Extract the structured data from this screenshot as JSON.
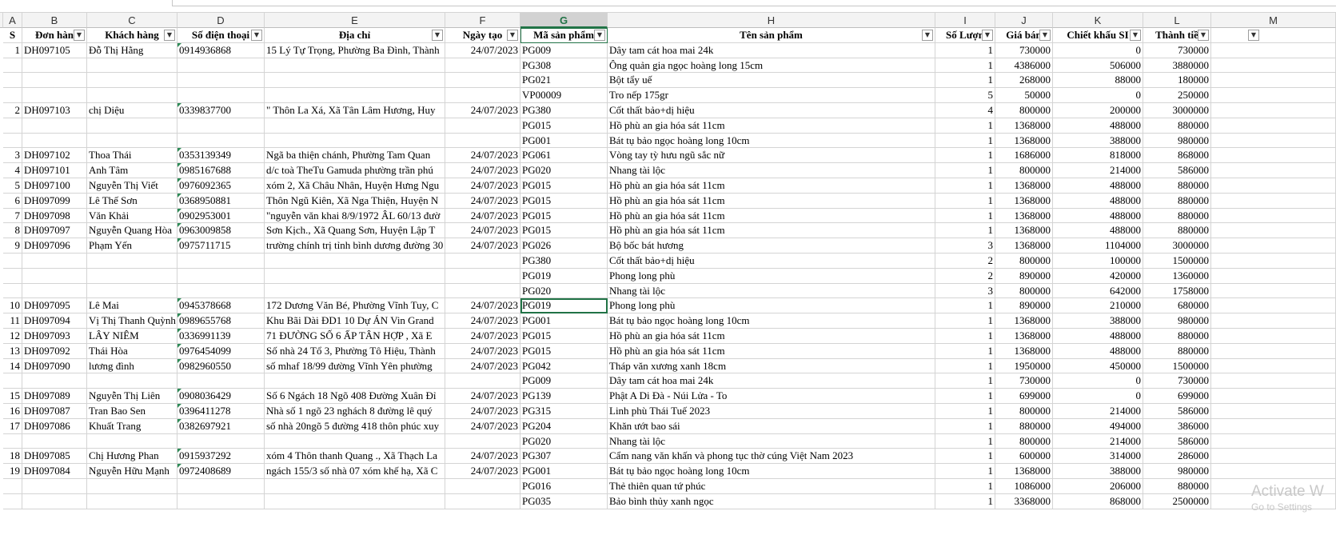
{
  "column_letters": [
    "A",
    "B",
    "C",
    "D",
    "E",
    "F",
    "G",
    "H",
    "I",
    "J",
    "K",
    "L",
    "M"
  ],
  "selected_column": "G",
  "headers": [
    "S",
    "Đơn hàn",
    "Khách hàng",
    "Số điện thoại",
    "Địa chỉ",
    "Ngày tạo",
    "Mã sản phẩm",
    "Tên sản phẩm",
    "Số Lượn",
    "Giá bán",
    "Chiết khấu SI",
    "Thành tiề"
  ],
  "rows": [
    {
      "stt": "1",
      "don": "DH097105",
      "kh": "Đỗ Thị Hằng",
      "sdt": "0914936868",
      "dc": "15 Lý Tự Trọng, Phường Ba Đình, Thành",
      "ngay": "24/07/2023",
      "ma": "PG009",
      "ten": "Dây tam cát hoa mai 24k",
      "sl": "1",
      "gia": "730000",
      "ck": "0",
      "tt": "730000"
    },
    {
      "stt": "",
      "don": "",
      "kh": "",
      "sdt": "",
      "dc": "",
      "ngay": "",
      "ma": "PG308",
      "ten": "Ông quản gia ngọc hoàng long 15cm",
      "sl": "1",
      "gia": "4386000",
      "ck": "506000",
      "tt": "3880000"
    },
    {
      "stt": "",
      "don": "",
      "kh": "",
      "sdt": "",
      "dc": "",
      "ngay": "",
      "ma": "PG021",
      "ten": "Bột tẩy uế",
      "sl": "1",
      "gia": "268000",
      "ck": "88000",
      "tt": "180000"
    },
    {
      "stt": "",
      "don": "",
      "kh": "",
      "sdt": "",
      "dc": "",
      "ngay": "",
      "ma": "VP00009",
      "ten": "Tro nếp 175gr",
      "sl": "5",
      "gia": "50000",
      "ck": "0",
      "tt": "250000"
    },
    {
      "stt": "2",
      "don": "DH097103",
      "kh": "chị  Diệu",
      "sdt": "0339837700",
      "dc": "\" Thôn La Xá, Xã Tân Lâm Hương, Huy",
      "ngay": "24/07/2023",
      "ma": "PG380",
      "ten": "Cốt thất bảo+dị hiệu",
      "sl": "4",
      "gia": "800000",
      "ck": "200000",
      "tt": "3000000"
    },
    {
      "stt": "",
      "don": "",
      "kh": "",
      "sdt": "",
      "dc": "",
      "ngay": "",
      "ma": "PG015",
      "ten": "Hồ phù an gia hóa sát 11cm",
      "sl": "1",
      "gia": "1368000",
      "ck": "488000",
      "tt": "880000"
    },
    {
      "stt": "",
      "don": "",
      "kh": "",
      "sdt": "",
      "dc": "",
      "ngay": "",
      "ma": "PG001",
      "ten": "Bát tụ bảo ngọc hoàng long 10cm",
      "sl": "1",
      "gia": "1368000",
      "ck": "388000",
      "tt": "980000"
    },
    {
      "stt": "3",
      "don": "DH097102",
      "kh": "Thoa  Thái",
      "sdt": "0353139349",
      "dc": "Ngã ba thiện chánh, Phường Tam Quan",
      "ngay": "24/07/2023",
      "ma": "PG061",
      "ten": "Vòng tay tỳ hưu ngũ sắc nữ",
      "sl": "1",
      "gia": "1686000",
      "ck": "818000",
      "tt": "868000"
    },
    {
      "stt": "4",
      "don": "DH097101",
      "kh": "Anh Tâm",
      "sdt": "0985167688",
      "dc": " d/c toà TheTu Gamuda phường trần phú",
      "ngay": "24/07/2023",
      "ma": "PG020",
      "ten": "Nhang tài lộc",
      "sl": "1",
      "gia": "800000",
      "ck": "214000",
      "tt": "586000"
    },
    {
      "stt": "5",
      "don": "DH097100",
      "kh": "Nguyễn Thị Viết",
      "sdt": "0976092365",
      "dc": "xóm 2, Xã Châu Nhân, Huyện Hưng Ngu",
      "ngay": "24/07/2023",
      "ma": "PG015",
      "ten": "Hồ phù an gia hóa sát 11cm",
      "sl": "1",
      "gia": "1368000",
      "ck": "488000",
      "tt": "880000"
    },
    {
      "stt": "6",
      "don": "DH097099",
      "kh": "Lê Thế Sơn",
      "sdt": "0368950881",
      "dc": "Thôn Ngũ Kiên, Xã Nga Thiện, Huyện N",
      "ngay": "24/07/2023",
      "ma": "PG015",
      "ten": "Hồ phù an gia hóa sát 11cm",
      "sl": "1",
      "gia": "1368000",
      "ck": "488000",
      "tt": "880000"
    },
    {
      "stt": "7",
      "don": "DH097098",
      "kh": "Văn  Khải",
      "sdt": "0902953001",
      "dc": "\"nguyễn văn khai 8/9/1972 ÂL 60/13 đườ",
      "ngay": "24/07/2023",
      "ma": "PG015",
      "ten": "Hồ phù an gia hóa sát 11cm",
      "sl": "1",
      "gia": "1368000",
      "ck": "488000",
      "tt": "880000"
    },
    {
      "stt": "8",
      "don": "DH097097",
      "kh": "Nguyễn Quang Hòa",
      "sdt": "0963009858",
      "dc": "Sơn Kịch., Xã Quang Sơn, Huyện Lập T",
      "ngay": "24/07/2023",
      "ma": "PG015",
      "ten": "Hồ phù an gia hóa sát 11cm",
      "sl": "1",
      "gia": "1368000",
      "ck": "488000",
      "tt": "880000"
    },
    {
      "stt": "9",
      "don": "DH097096",
      "kh": "Phạm  Yến",
      "sdt": "0975711715",
      "dc": "trường chính trị tỉnh bình dương đường 30",
      "ngay": "24/07/2023",
      "ma": "PG026",
      "ten": "Bộ bốc bát hương",
      "sl": "3",
      "gia": "1368000",
      "ck": "1104000",
      "tt": "3000000"
    },
    {
      "stt": "",
      "don": "",
      "kh": "",
      "sdt": "",
      "dc": "",
      "ngay": "",
      "ma": "PG380",
      "ten": "Cốt thất bảo+dị hiệu",
      "sl": "2",
      "gia": "800000",
      "ck": "100000",
      "tt": "1500000"
    },
    {
      "stt": "",
      "don": "",
      "kh": "",
      "sdt": "",
      "dc": "",
      "ngay": "",
      "ma": "PG019",
      "ten": "Phong long phù",
      "sl": "2",
      "gia": "890000",
      "ck": "420000",
      "tt": "1360000"
    },
    {
      "stt": "",
      "don": "",
      "kh": "",
      "sdt": "",
      "dc": "",
      "ngay": "",
      "ma": "PG020",
      "ten": "Nhang tài lộc",
      "sl": "3",
      "gia": "800000",
      "ck": "642000",
      "tt": "1758000"
    },
    {
      "stt": "10",
      "don": "DH097095",
      "kh": "Lê  Mai",
      "sdt": "0945378668",
      "dc": "172 Dương Văn Bé, Phường Vĩnh Tuy, C",
      "ngay": "24/07/2023",
      "ma": "PG019",
      "ten": "Phong long phù",
      "sl": "1",
      "gia": "890000",
      "ck": "210000",
      "tt": "680000"
    },
    {
      "stt": "11",
      "don": "DH097094",
      "kh": "Vị Thị Thanh Quỳnh",
      "sdt": "0989655768",
      "dc": "Khu Bãi Dài ĐD1 10 Dự ÁN Vin Grand",
      "ngay": "24/07/2023",
      "ma": "PG001",
      "ten": "Bát tụ bảo ngọc hoàng long 10cm",
      "sl": "1",
      "gia": "1368000",
      "ck": "388000",
      "tt": "980000"
    },
    {
      "stt": "12",
      "don": "DH097093",
      "kh": "LÂY NIÊM",
      "sdt": "0336991139",
      "dc": "71 ĐƯỜNG SỐ 6 ẤP TÂN HỢP , Xã E",
      "ngay": "24/07/2023",
      "ma": "PG015",
      "ten": "Hồ phù an gia hóa sát 11cm",
      "sl": "1",
      "gia": "1368000",
      "ck": "488000",
      "tt": "880000"
    },
    {
      "stt": "13",
      "don": "DH097092",
      "kh": "Thái Hòa",
      "sdt": "0976454099",
      "dc": "Số nhà 24 Tổ 3, Phường Tô Hiệu, Thành",
      "ngay": "24/07/2023",
      "ma": "PG015",
      "ten": "Hồ phù an gia hóa sát 11cm",
      "sl": "1",
      "gia": "1368000",
      "ck": "488000",
      "tt": "880000"
    },
    {
      "stt": "14",
      "don": "DH097090",
      "kh": "lương  đình",
      "sdt": "0982960550",
      "dc": "số mhaf 18/99 đường Vĩnh Yên phường",
      "ngay": "24/07/2023",
      "ma": "PG042",
      "ten": "Tháp văn xương xanh 18cm",
      "sl": "1",
      "gia": "1950000",
      "ck": "450000",
      "tt": "1500000"
    },
    {
      "stt": "",
      "don": "",
      "kh": "",
      "sdt": "",
      "dc": "",
      "ngay": "",
      "ma": "PG009",
      "ten": "Dây tam cát hoa mai 24k",
      "sl": "1",
      "gia": "730000",
      "ck": "0",
      "tt": "730000"
    },
    {
      "stt": "15",
      "don": "DH097089",
      "kh": "Nguyễn Thị Liên",
      "sdt": "0908036429",
      "dc": "Số 6 Ngách 18 Ngõ 408 Đường Xuân Đỉ",
      "ngay": "24/07/2023",
      "ma": "PG139",
      "ten": "Phật A Di Đà - Núi Lửa - To",
      "sl": "1",
      "gia": "699000",
      "ck": "0",
      "tt": "699000"
    },
    {
      "stt": "16",
      "don": "DH097087",
      "kh": "Tran Bao Sen",
      "sdt": "0396411278",
      "dc": "Nhà số 1 ngõ 23 nghách 8 đường lê quý",
      "ngay": "24/07/2023",
      "ma": "PG315",
      "ten": "Linh phù Thái Tuế 2023",
      "sl": "1",
      "gia": "800000",
      "ck": "214000",
      "tt": "586000"
    },
    {
      "stt": "17",
      "don": "DH097086",
      "kh": "Khuất Trang",
      "sdt": "0382697921",
      "dc": "số nhà 20ngõ 5 đường 418 thôn phúc xuy",
      "ngay": "24/07/2023",
      "ma": "PG204",
      "ten": "Khăn ướt bao sái",
      "sl": "1",
      "gia": "880000",
      "ck": "494000",
      "tt": "386000"
    },
    {
      "stt": "",
      "don": "",
      "kh": "",
      "sdt": "",
      "dc": "",
      "ngay": "",
      "ma": "PG020",
      "ten": "Nhang tài lộc",
      "sl": "1",
      "gia": "800000",
      "ck": "214000",
      "tt": "586000"
    },
    {
      "stt": "18",
      "don": "DH097085",
      "kh": "Chị Hương Phan",
      "sdt": "0915937292",
      "dc": "xóm 4 Thôn thanh Quang ., Xã Thạch La",
      "ngay": "24/07/2023",
      "ma": "PG307",
      "ten": "Cẩm nang văn khấn và phong tục thờ cúng Việt Nam 2023",
      "sl": "1",
      "gia": "600000",
      "ck": "314000",
      "tt": "286000"
    },
    {
      "stt": "19",
      "don": "DH097084",
      "kh": "Nguyễn Hữu Mạnh",
      "sdt": "0972408689",
      "dc": "ngách 155/3 số nhà 07 xóm khế hạ, Xã C",
      "ngay": "24/07/2023",
      "ma": "PG001",
      "ten": "Bát tụ bảo ngọc hoàng long 10cm",
      "sl": "1",
      "gia": "1368000",
      "ck": "388000",
      "tt": "980000"
    },
    {
      "stt": "",
      "don": "",
      "kh": "",
      "sdt": "",
      "dc": "",
      "ngay": "",
      "ma": "PG016",
      "ten": "Thẻ thiên quan tứ phúc",
      "sl": "1",
      "gia": "1086000",
      "ck": "206000",
      "tt": "880000"
    },
    {
      "stt": "",
      "don": "",
      "kh": "",
      "sdt": "",
      "dc": "",
      "ngay": "",
      "ma": "PG035",
      "ten": "Bảo bình thủy xanh ngọc",
      "sl": "1",
      "gia": "3368000",
      "ck": "868000",
      "tt": "2500000"
    }
  ],
  "active_cell_row": 17,
  "watermark": {
    "line1": "Activate W",
    "line2": "Go to Settings"
  },
  "colors": {
    "accent": "#217346",
    "grid": "#d4d4d4",
    "header_bg": "#f3f3f3",
    "comment_triangle": "#2e8b57"
  }
}
